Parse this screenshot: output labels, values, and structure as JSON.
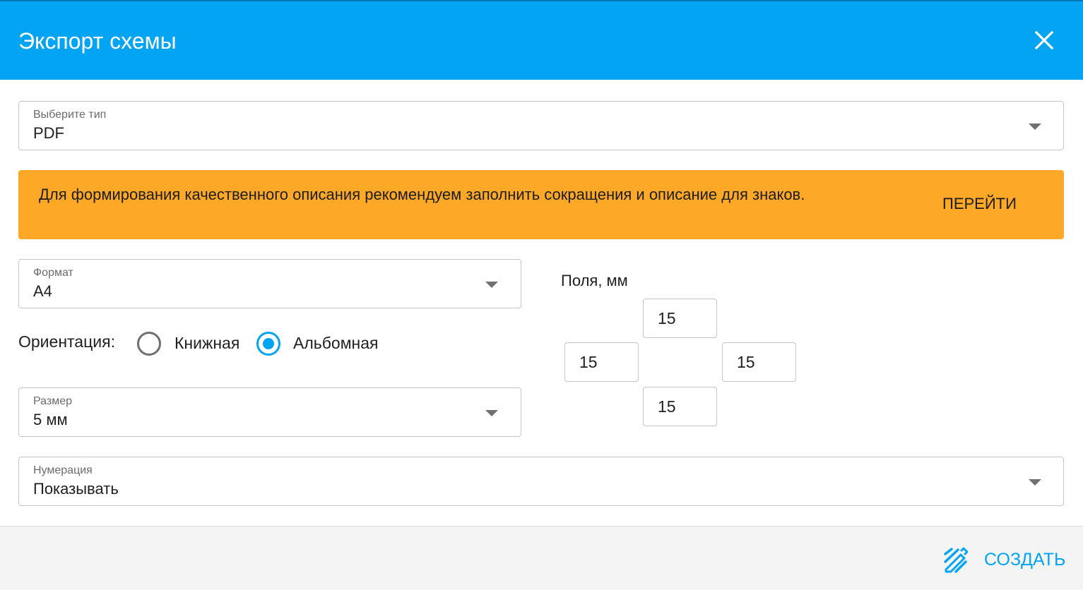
{
  "dialog": {
    "title": "Экспорт схемы",
    "close_icon": "close-icon",
    "accent_color": "#03a4f4"
  },
  "type_select": {
    "label": "Выберите тип",
    "value": "PDF"
  },
  "warning": {
    "text": "Для формирования качественного описания рекомендуем заполнить сокращения и описание для знаков.",
    "action_label": "ПЕРЕЙТИ",
    "color": "#fda827"
  },
  "format_select": {
    "label": "Формат",
    "value": "A4"
  },
  "orientation": {
    "label": "Ориентация:",
    "options": [
      {
        "label": "Книжная",
        "selected": false
      },
      {
        "label": "Альбомная",
        "selected": true
      }
    ]
  },
  "size_select": {
    "label": "Размер",
    "value": "5 мм"
  },
  "margins": {
    "title": "Поля, мм",
    "top": "15",
    "left": "15",
    "right": "15",
    "bottom": "15"
  },
  "numbering_select": {
    "label": "Нумерация",
    "value": "Показывать"
  },
  "footer": {
    "create_label": "СОЗДАТЬ",
    "create_icon": "draw-icon"
  }
}
